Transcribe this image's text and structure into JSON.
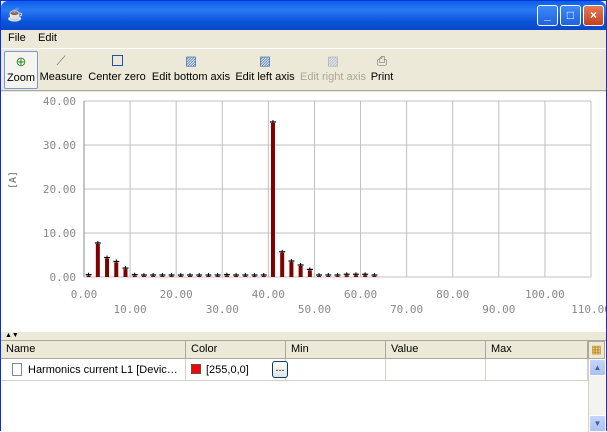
{
  "window": {
    "title": "",
    "app_icon": "java-icon"
  },
  "menu": {
    "file": "File",
    "edit": "Edit"
  },
  "toolbar": {
    "zoom": "Zoom",
    "measure": "Measure",
    "center_zero": "Center zero",
    "edit_bottom_axis": "Edit bottom axis",
    "edit_left_axis": "Edit left axis",
    "edit_right_axis": "Edit right axis",
    "print": "Print"
  },
  "chart_data": {
    "type": "bar",
    "ylabel": "[A]",
    "xlabel": "",
    "xlim": [
      0,
      110
    ],
    "ylim": [
      0,
      40
    ],
    "x_ticks": [
      "0.00",
      "10.00",
      "20.00",
      "30.00",
      "40.00",
      "50.00",
      "60.00",
      "70.00",
      "80.00",
      "90.00",
      "100.00",
      "110.00"
    ],
    "y_ticks": [
      "0.00",
      "10.00",
      "20.00",
      "30.00",
      "40.00"
    ],
    "series": [
      {
        "color": "#800000",
        "x": [
          1,
          3,
          5,
          7,
          9,
          11,
          13,
          15,
          17,
          19,
          21,
          23,
          25,
          27,
          29,
          31,
          33,
          35,
          37,
          39,
          41,
          43,
          45,
          47,
          49,
          51,
          53,
          55,
          57,
          59,
          61,
          63
        ],
        "values": [
          0.3,
          7.5,
          4.2,
          3.3,
          1.8,
          0.3,
          0.2,
          0.2,
          0.2,
          0.2,
          0.2,
          0.2,
          0.2,
          0.1,
          0.1,
          0.3,
          0.1,
          0.1,
          0.1,
          0.1,
          35,
          5.5,
          3.4,
          2.5,
          1.5,
          0.2,
          0.2,
          0.2,
          0.4,
          0.4,
          0.4,
          0.1
        ]
      }
    ]
  },
  "table": {
    "columns": [
      "Name",
      "Color",
      "Min",
      "Value",
      "Max"
    ],
    "rows": [
      {
        "name": "Harmonics current L1 [Devic…",
        "color_text": "[255,0,0]",
        "swatch": "#ff0000",
        "button": "...",
        "min": "",
        "value": "",
        "max": ""
      }
    ]
  }
}
